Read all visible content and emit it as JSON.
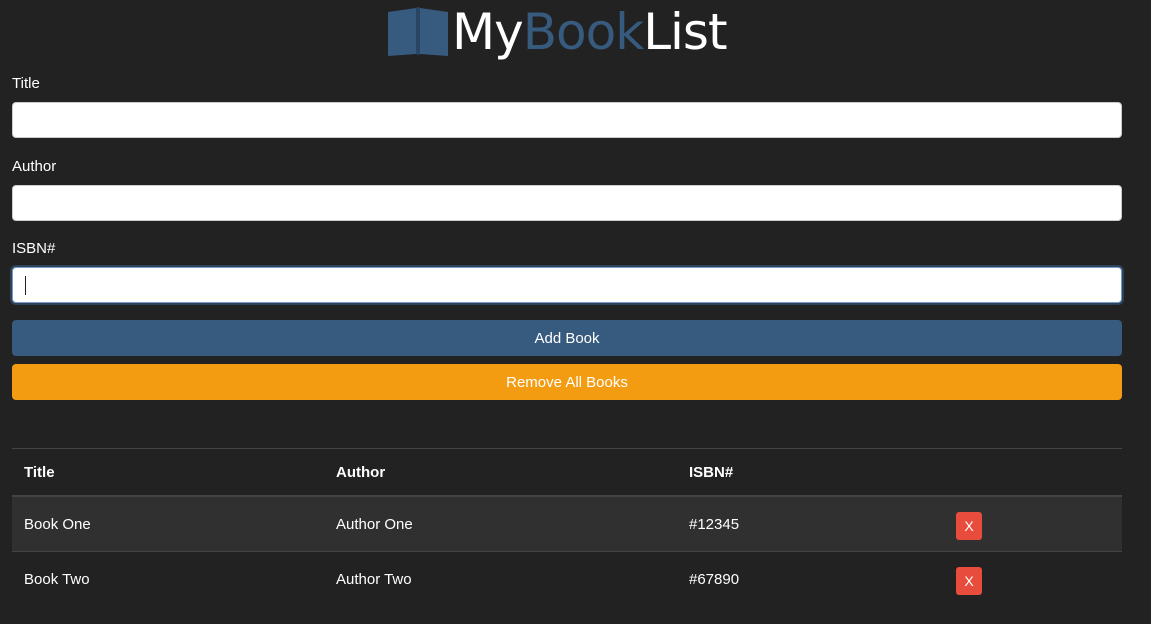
{
  "header": {
    "logo_my": "My",
    "logo_book": "Book",
    "logo_list": "List"
  },
  "form": {
    "title_label": "Title",
    "title_value": "",
    "author_label": "Author",
    "author_value": "",
    "isbn_label": "ISBN#",
    "isbn_value": "",
    "add_button": "Add Book",
    "remove_all_button": "Remove All Books"
  },
  "table": {
    "headers": [
      "Title",
      "Author",
      "ISBN#"
    ],
    "rows": [
      {
        "title": "Book One",
        "author": "Author One",
        "isbn": "#12345",
        "delete": "X"
      },
      {
        "title": "Book Two",
        "author": "Author Two",
        "isbn": "#67890",
        "delete": "X"
      }
    ]
  },
  "colors": {
    "background": "#222222",
    "primary": "#375a7f",
    "warning": "#f39c12",
    "danger": "#e74c3c"
  },
  "icons": {
    "logo": "open-book-icon"
  }
}
